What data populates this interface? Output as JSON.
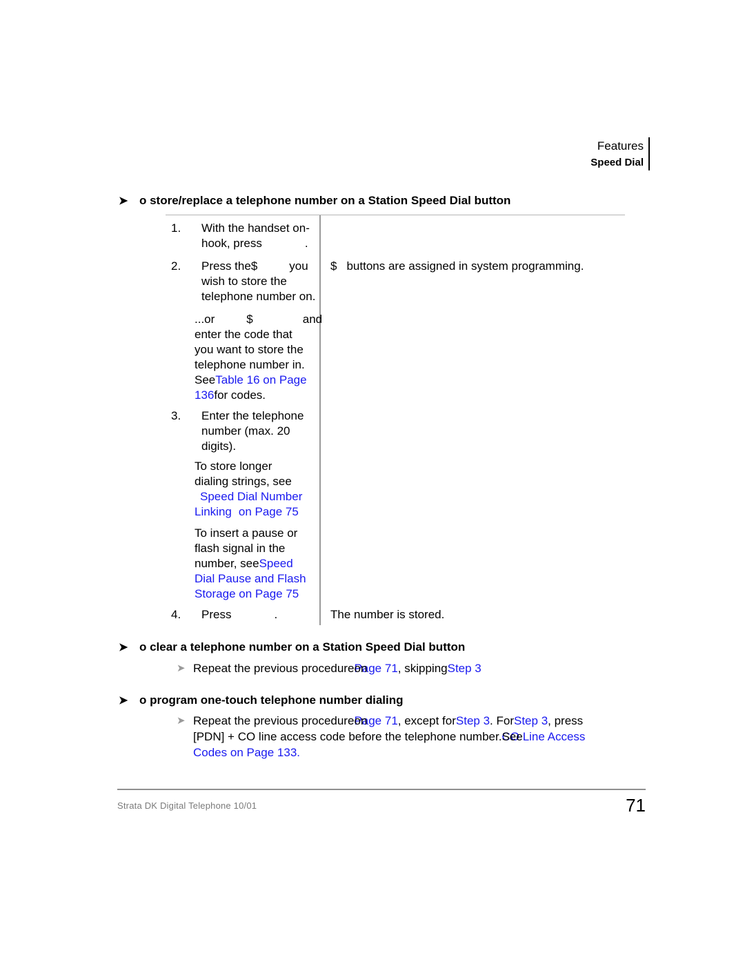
{
  "header": {
    "line1": "Features",
    "line2": "Speed Dial"
  },
  "sections": [
    {
      "arrow": "➤",
      "title": "o store/replace a telephone number on a Station Speed Dial button"
    },
    {
      "arrow": "➤",
      "title": "o clear a telephone number on a Station Speed Dial button"
    },
    {
      "arrow": "➤",
      "title": "o program one-touch telephone number dialing"
    }
  ],
  "procedure": {
    "steps": [
      {
        "number": "1.",
        "line1": "With the handset on-",
        "line2_pre": "hook, press",
        "line2_post": "."
      },
      {
        "number": "2.",
        "line1_pre": "Press the",
        "line1_sym": "$",
        "line1_post": "you",
        "line2": "wish to store the",
        "line3_pre": "telephone number on",
        "line3_post": "."
      },
      {
        "number": "3.",
        "line1": "Enter the telephone",
        "line2": "number (max. 20",
        "line3": "digits)."
      },
      {
        "number": "4.",
        "line1_pre": "Press",
        "line1_post": "."
      }
    ],
    "sub_step2": {
      "l1_pre": "...or",
      "l1_sym": "$",
      "l1_post": "and",
      "l2": "enter the code that",
      "l3": "you want to store the",
      "l4_pre": "telephone number in",
      "l4_post": ".",
      "l5_pre": "See",
      "l5_link": "Table 16 on Page",
      "l6_link": "136",
      "l6_post": "for codes."
    },
    "sub_step3_a": {
      "l1": "To store longer",
      "l2": "dialing strings, see",
      "l3_link": "Speed Dial Number",
      "l4_link": "Linking",
      "l4_link2": "on Page 75"
    },
    "sub_step3_b": {
      "l1": "To insert a pause or",
      "l2": "flash signal in the",
      "l3_pre": "number, see",
      "l3_link": "Speed",
      "l4_link": "Dial Pause and Flash",
      "l5_link": "Storage on Page 75"
    },
    "right_column": {
      "row2_sym": "$",
      "row2_text": "buttons are assigned in system programming.",
      "row4_text": "The number is stored."
    }
  },
  "clear_section": {
    "bullet": "➤",
    "pre": "Repeat the previous procedure",
    "overlap_black": "on",
    "link1": "Page 71",
    "mid": ", skipping",
    "link2": "Step 3"
  },
  "program_section": {
    "bullet": "➤",
    "line1_pre": "Repeat the previous procedure",
    "line1_overlap_black": "on",
    "line1_link1": "Page 71",
    "line1_mid": ", except for",
    "line1_link2": "Step 3",
    "line1_mid2": ". For",
    "line1_link3": "Step 3",
    "line1_end": ", press",
    "line2_pre": "[PDN] + CO line access code before the telephone number.",
    "line2_overlap_black": "See",
    "line2_link": "CO Line Access",
    "line3_link": "Codes on Page 133."
  },
  "footer": {
    "left": "Strata DK Digital Telephone    10/01",
    "page": "71"
  },
  "colors": {
    "link": "#1a1af0",
    "bullet_gray": "#9a9a9a",
    "footer_gray": "#7a7a7a"
  }
}
